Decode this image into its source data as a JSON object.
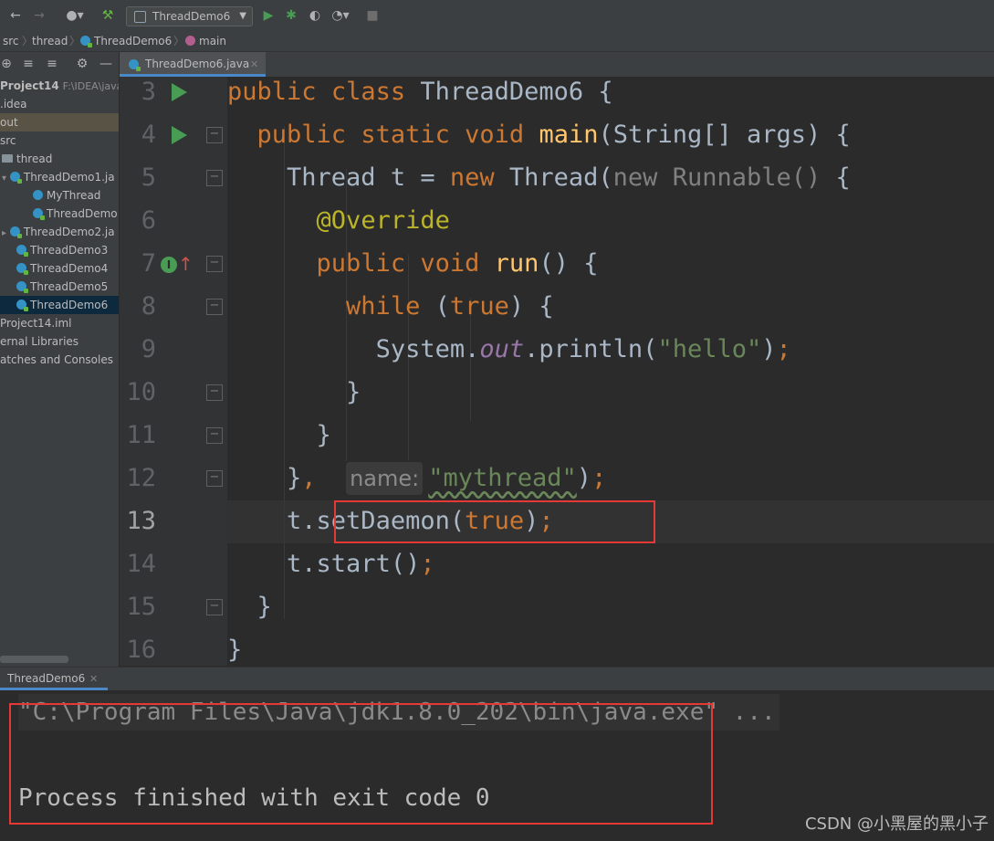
{
  "toolbar": {
    "run_config": "ThreadDemo6",
    "icons": [
      "back-arrow-icon",
      "forward-arrow-icon",
      "user-icon",
      "build-hammer-icon",
      "run-icon",
      "debug-bug-icon",
      "coverage-icon",
      "profile-icon",
      "stop-icon"
    ]
  },
  "breadcrumb": {
    "items": [
      "src",
      "thread",
      "ThreadDemo6",
      "main"
    ]
  },
  "project": {
    "rows": [
      {
        "label": "Project14",
        "extra": "F:\\IDEA\\javaco"
      },
      {
        "label": ".idea"
      },
      {
        "label": "out"
      },
      {
        "label": "src"
      },
      {
        "label": "thread"
      },
      {
        "label": "ThreadDemo1.ja"
      },
      {
        "label": "MyThread"
      },
      {
        "label": "ThreadDemo"
      },
      {
        "label": "ThreadDemo2.ja"
      },
      {
        "label": "ThreadDemo3"
      },
      {
        "label": "ThreadDemo4"
      },
      {
        "label": "ThreadDemo5"
      },
      {
        "label": "ThreadDemo6"
      },
      {
        "label": "Project14.iml"
      },
      {
        "label": "ernal Libraries"
      },
      {
        "label": "atches and Consoles"
      }
    ]
  },
  "editor": {
    "tab_label": "ThreadDemo6.java",
    "line_numbers": [
      "3",
      "4",
      "5",
      "6",
      "7",
      "8",
      "9",
      "10",
      "11",
      "12",
      "13",
      "14",
      "15",
      "16"
    ],
    "code": {
      "l3": [
        "public",
        "class",
        "ThreadDemo6 {"
      ],
      "l4": [
        "public",
        "static",
        "void",
        "main",
        "(String[] args) {"
      ],
      "l5": [
        "Thread t = ",
        "new",
        " Thread(",
        "new Runnable()",
        " {"
      ],
      "l6": [
        "@Override"
      ],
      "l7": [
        "public",
        "void",
        "run",
        "() {"
      ],
      "l8": [
        "while",
        " (",
        "true",
        ") {"
      ],
      "l9": [
        "System.",
        "out",
        ".println(",
        "\"hello\"",
        ")",
        ";"
      ],
      "l10": [
        "}"
      ],
      "l11": [
        "}"
      ],
      "l12": [
        "}",
        ",",
        "name:",
        "\"mythread\"",
        ")",
        ";"
      ],
      "l13": [
        "t.setDaemon(",
        "true",
        ")",
        ";"
      ],
      "l14": [
        "t.start()",
        ";"
      ],
      "l15": [
        "}"
      ],
      "l16": [
        "}"
      ]
    }
  },
  "run_panel": {
    "tab_label": "ThreadDemo6",
    "command_line": "\"C:\\Program Files\\Java\\jdk1.8.0_202\\bin\\java.exe\" ...",
    "exit_message": "Process finished with exit code 0"
  },
  "watermark": "CSDN @小黑屋的黑小子",
  "colors": {
    "keyword": "#cc7832",
    "function": "#ffc66d",
    "string": "#6a8759",
    "annotation": "#bbb529",
    "highlight_box": "#e53935"
  }
}
